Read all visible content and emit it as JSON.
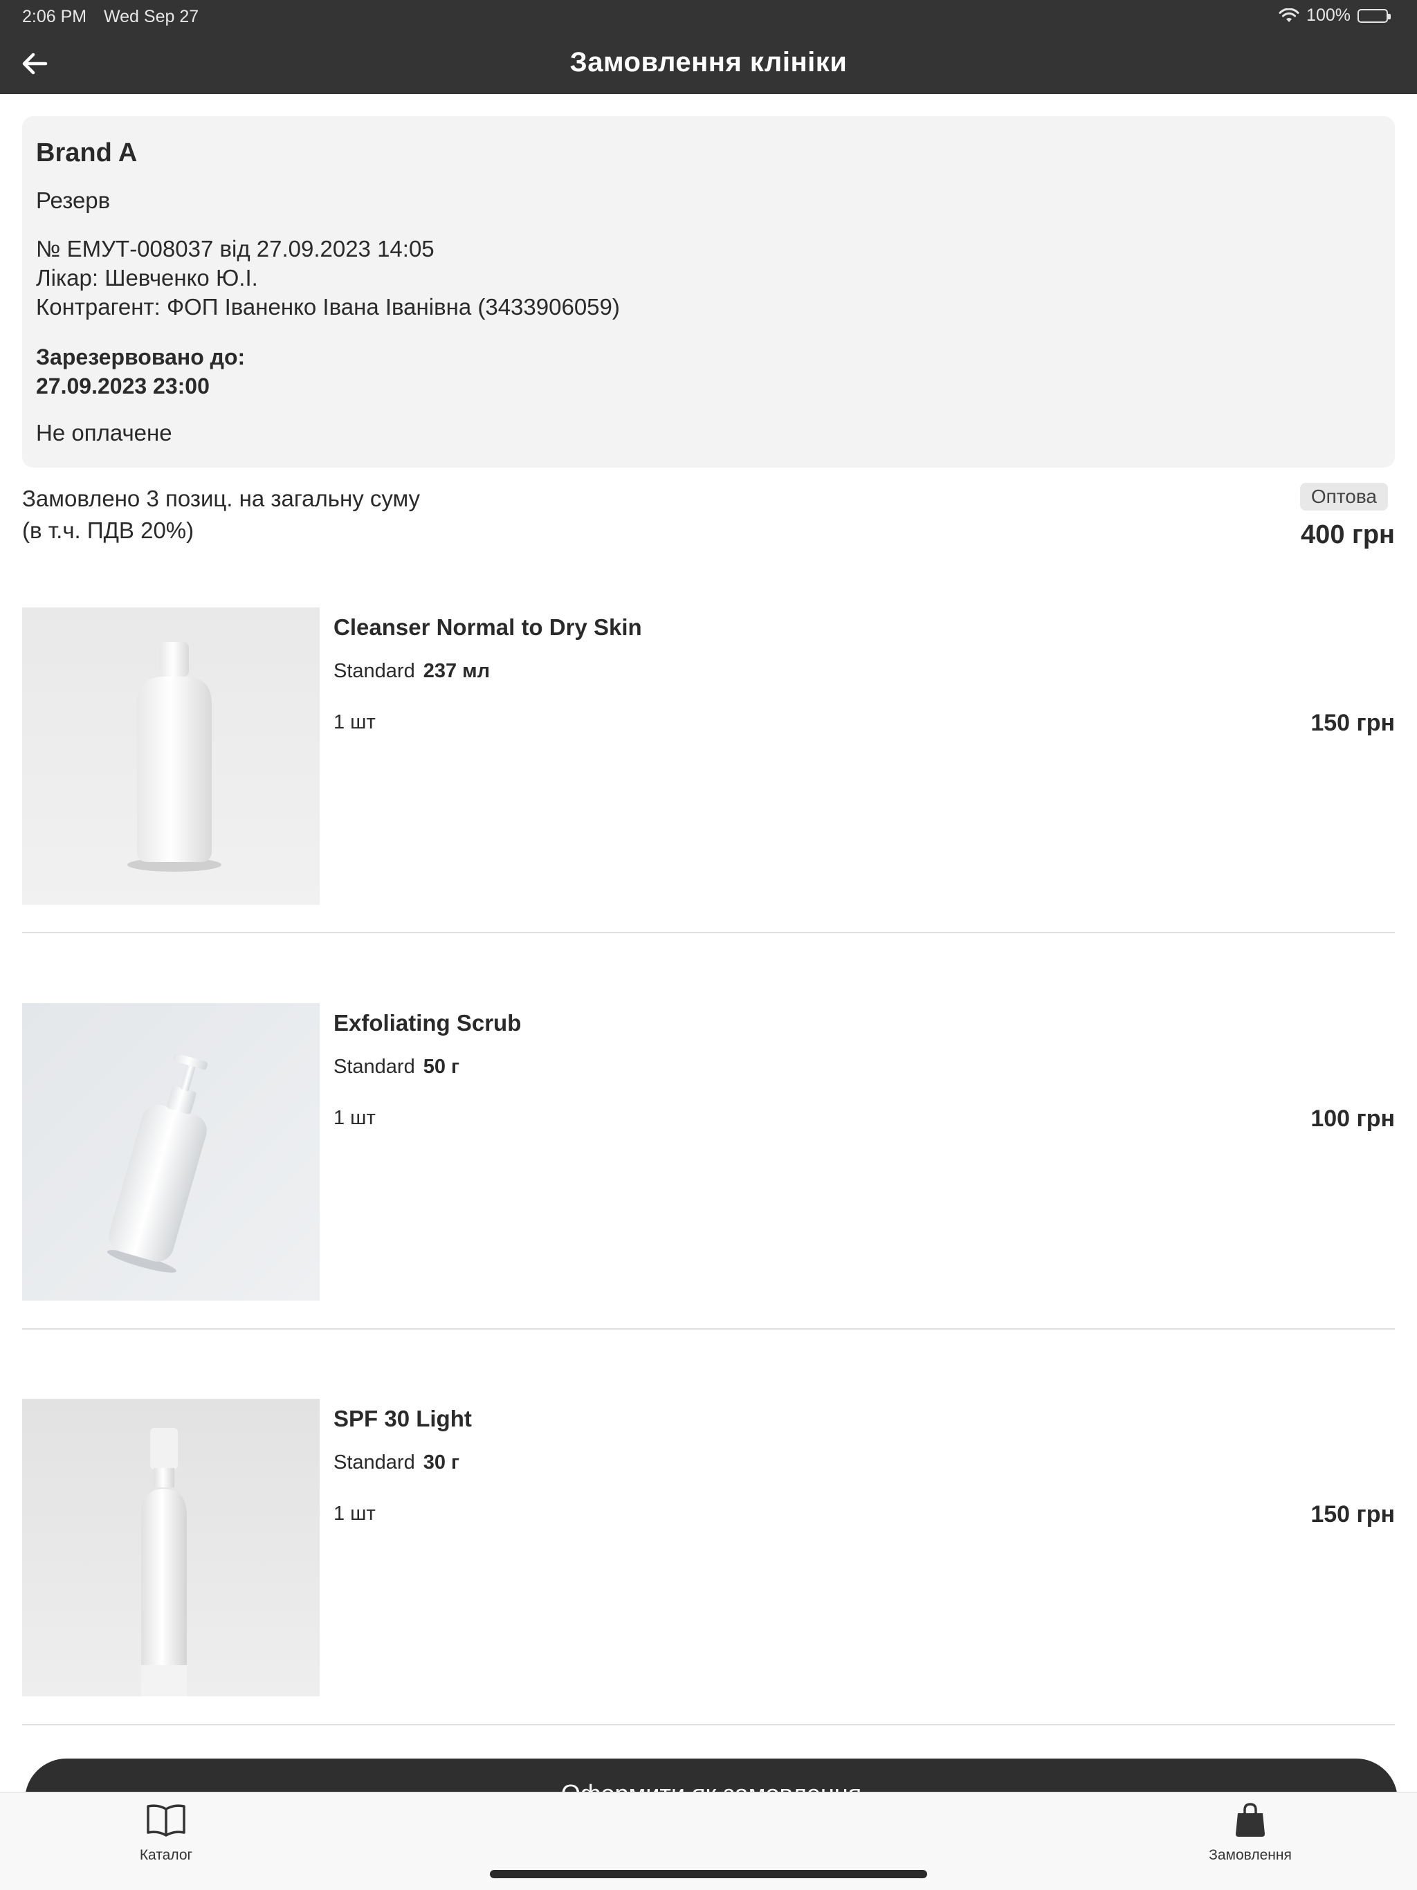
{
  "status_bar": {
    "time": "2:06 PM",
    "date": "Wed Sep 27",
    "battery": "100%"
  },
  "header": {
    "title": "Замовлення клініки"
  },
  "order": {
    "brand": "Brand A",
    "status": "Резерв",
    "number_line": "№ ЕМУТ-008037 від 27.09.2023 14:05",
    "doctor_line": "Лікар: Шевченко Ю.І.",
    "contractor_line": "Контрагент: ФОП Іваненко Івана Іванівна (3433906059)",
    "reserved_label": "Зарезервовано до:",
    "reserved_until": "27.09.2023 23:00",
    "payment_status": "Не оплачене"
  },
  "summary": {
    "line1": "Замовлено 3 позиц. на загальну суму",
    "line2": "(в т.ч. ПДВ 20%)",
    "price_type": "Оптова",
    "total": "400 грн"
  },
  "items": [
    {
      "name": "Cleanser Normal to Dry Skin",
      "variant": "Standard",
      "size": "237 мл",
      "qty": "1 шт",
      "price": "150 грн"
    },
    {
      "name": "Exfoliating Scrub",
      "variant": "Standard",
      "size": "50 г",
      "qty": "1 шт",
      "price": "100 грн"
    },
    {
      "name": "SPF 30 Light",
      "variant": "Standard",
      "size": "30 г",
      "qty": "1 шт",
      "price": "150 грн"
    }
  ],
  "cta": {
    "label": "Оформити як замовлення"
  },
  "tabbar": {
    "catalog": {
      "label": "Каталог",
      "icon": "book-icon"
    },
    "orders": {
      "label": "Замовлення",
      "icon": "shopping-bag-icon"
    }
  }
}
